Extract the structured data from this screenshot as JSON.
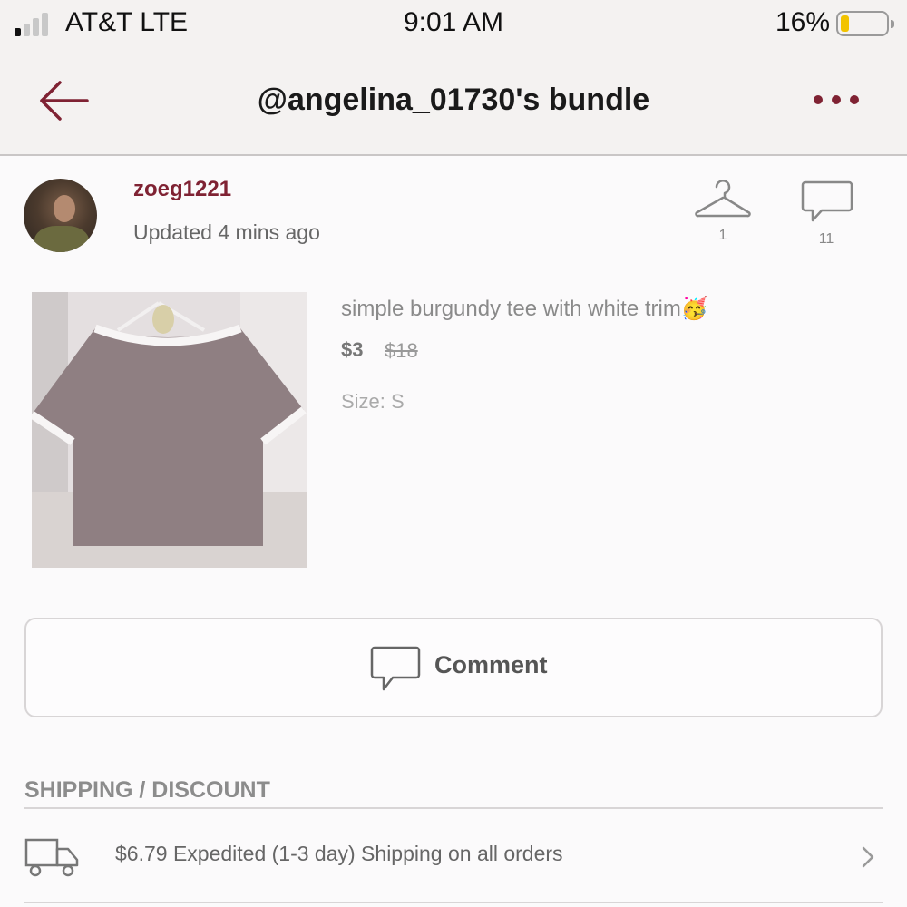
{
  "status_bar": {
    "carrier": "AT&T LTE",
    "time": "9:01 AM",
    "battery_percent": "16%",
    "battery_level": 0.16,
    "signal_bars_active": 1,
    "signal_bars_total": 4
  },
  "header": {
    "title": "@angelina_01730's bundle",
    "back_icon": "arrow-left-icon",
    "more_icon": "more-dots-icon"
  },
  "seller": {
    "username": "zoeg1221",
    "updated": "Updated 4 mins ago",
    "likes_count": "1",
    "comments_count": "11"
  },
  "product": {
    "title": "simple burgundy tee with white trim",
    "emoji": "🥳",
    "price": "$3",
    "original_price": "$18",
    "size": "Size: S"
  },
  "comment_button": {
    "label": "Comment"
  },
  "shipping": {
    "section_title": "SHIPPING / DISCOUNT",
    "text": "$6.79 Expedited (1-3 day) Shipping on all orders"
  },
  "colors": {
    "accent": "#7f2233",
    "background": "#fbfafb",
    "header_bg": "#f4f2f1"
  }
}
